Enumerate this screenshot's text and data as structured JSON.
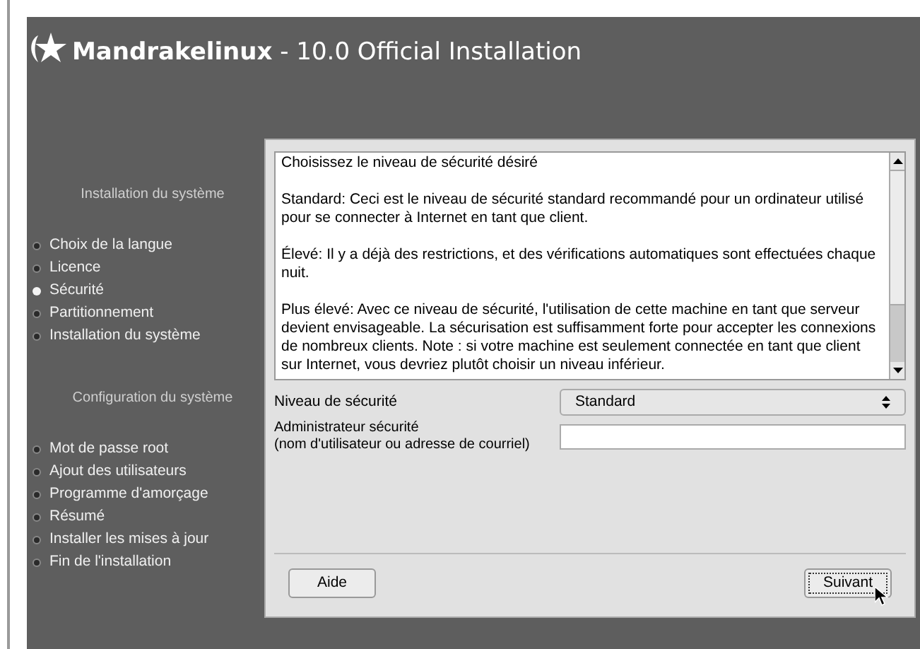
{
  "header": {
    "brand": "Mandrakelinux",
    "subtitle": " - 10.0 Official Installation"
  },
  "sidebar": {
    "sections": [
      {
        "heading": "Installation du système",
        "items": [
          {
            "label": "Choix de la langue",
            "selected": false
          },
          {
            "label": "Licence",
            "selected": false
          },
          {
            "label": "Sécurité",
            "selected": true
          },
          {
            "label": "Partitionnement",
            "selected": false
          },
          {
            "label": "Installation du système",
            "selected": false
          }
        ]
      },
      {
        "heading": "Configuration du système",
        "items": [
          {
            "label": "Mot de passe root",
            "selected": false
          },
          {
            "label": "Ajout des utilisateurs",
            "selected": false
          },
          {
            "label": "Programme d'amorçage",
            "selected": false
          },
          {
            "label": "Résumé",
            "selected": false
          },
          {
            "label": "Installer les mises à jour",
            "selected": false
          },
          {
            "label": "Fin de l'installation",
            "selected": false
          }
        ]
      }
    ]
  },
  "description": [
    "Choisissez le niveau de sécurité désiré",
    "Standard: Ceci est le niveau de sécurité standard recommandé pour un ordinateur utilisé pour se connecter à Internet en tant que client.",
    "Élevé: Il y a déjà des restrictions, et des vérifications automatiques sont effectuées chaque nuit.",
    "Plus élevé: Avec ce niveau de sécurité, l'utilisation de cette machine en tant que serveur devient envisageable. La sécurisation est suffisamment forte pour accepter les connexions de nombreux clients. Note : si votre machine est seulement connectée en tant que client sur Internet, vous devriez plutôt choisir un niveau inférieur."
  ],
  "security_level": {
    "label": "Niveau de sécurité",
    "value": "Standard"
  },
  "security_admin": {
    "label_lines": [
      "Administrateur sécurité",
      "(nom d'utilisateur ou adresse de courriel)"
    ]
  },
  "buttons": [
    {
      "label": "Aide",
      "focused": false
    },
    {
      "label": "Suivant",
      "focused": true
    }
  ]
}
